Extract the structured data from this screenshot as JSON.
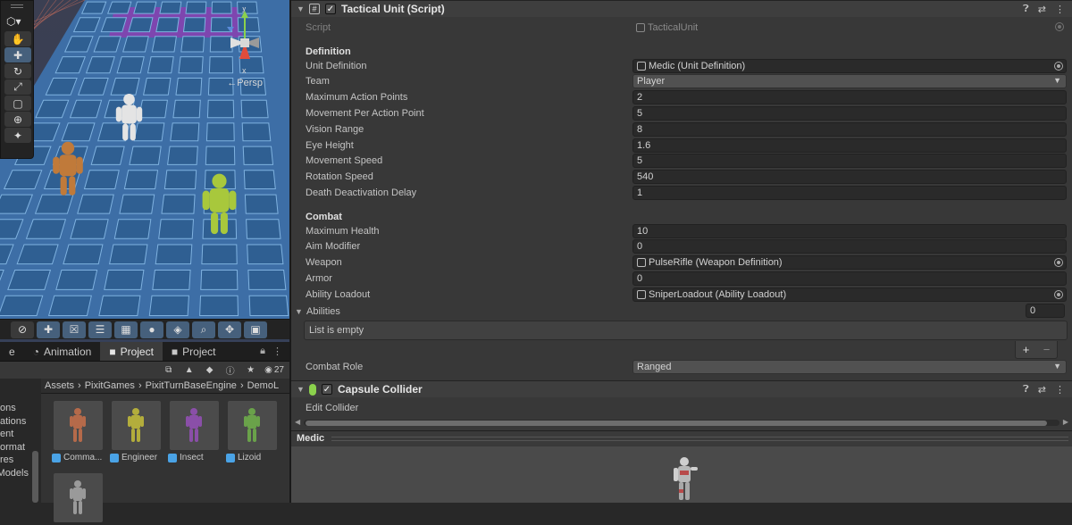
{
  "scene": {
    "persp_label": "←Persp",
    "axis_y": "y",
    "axis_x": "x",
    "tools": [
      "hand-tool",
      "move-tool",
      "rotate-tool",
      "scale-tool",
      "rect-tool",
      "transform-tool",
      "custom-tool"
    ],
    "selected_tool": "move-tool",
    "toolbar_icons": [
      "compass-icon",
      "move-icon",
      "crossed-icon",
      "sliders-icon",
      "grid-icon",
      "sphere-icon",
      "layers-icon",
      "search-icon",
      "move-icon",
      "camera-icon"
    ]
  },
  "tabs": {
    "items": [
      {
        "label": "e",
        "icon": ""
      },
      {
        "label": "Animation",
        "icon": "clock-icon"
      },
      {
        "label": "Project",
        "icon": "folder-icon"
      },
      {
        "label": "Project",
        "icon": "folder-icon"
      }
    ],
    "active_index": 2
  },
  "project": {
    "visible_count": "27",
    "tree": [
      "ons",
      "ations",
      "ent",
      "ormat",
      "res",
      "Models"
    ],
    "breadcrumb": [
      "Assets",
      "PixitGames",
      "PixitTurnBaseEngine",
      "DemoL"
    ],
    "assets": [
      {
        "label": "Comma...",
        "color": "#b56a4a"
      },
      {
        "label": "Engineer",
        "color": "#b3ad3c"
      },
      {
        "label": "Insect",
        "color": "#8a4fa8"
      },
      {
        "label": "Lizoid",
        "color": "#6aa24a"
      },
      {
        "label": "",
        "color": "#9a9a9a"
      }
    ]
  },
  "inspector": {
    "tactical_unit": {
      "title": "Tactical Unit (Script)",
      "script_label": "Script",
      "script_value": "TacticalUnit",
      "definition_header": "Definition",
      "definition": [
        {
          "label": "Unit Definition",
          "value": "Medic (Unit Definition)",
          "kind": "object"
        },
        {
          "label": "Team",
          "value": "Player",
          "kind": "dropdown"
        },
        {
          "label": "Maximum Action Points",
          "value": "2",
          "kind": "text"
        },
        {
          "label": "Movement Per Action Point",
          "value": "5",
          "kind": "text"
        },
        {
          "label": "Vision Range",
          "value": "8",
          "kind": "text"
        },
        {
          "label": "Eye Height",
          "value": "1.6",
          "kind": "text"
        },
        {
          "label": "Movement Speed",
          "value": "5",
          "kind": "text"
        },
        {
          "label": "Rotation Speed",
          "value": "540",
          "kind": "text"
        },
        {
          "label": "Death Deactivation Delay",
          "value": "1",
          "kind": "text"
        }
      ],
      "combat_header": "Combat",
      "combat": [
        {
          "label": "Maximum Health",
          "value": "10",
          "kind": "text"
        },
        {
          "label": "Aim Modifier",
          "value": "0",
          "kind": "text"
        },
        {
          "label": "Weapon",
          "value": "PulseRifle (Weapon Definition)",
          "kind": "object"
        },
        {
          "label": "Armor",
          "value": "0",
          "kind": "text"
        },
        {
          "label": "Ability Loadout",
          "value": "SniperLoadout (Ability Loadout)",
          "kind": "object"
        }
      ],
      "abilities_label": "Abilities",
      "abilities_count": "0",
      "list_empty": "List is empty",
      "add_label": "+",
      "remove_label": "−",
      "combat_role_label": "Combat Role",
      "combat_role_value": "Ranged"
    },
    "capsule_collider": {
      "title": "Capsule Collider",
      "edit_collider": "Edit Collider"
    },
    "preview_title": "Medic"
  }
}
